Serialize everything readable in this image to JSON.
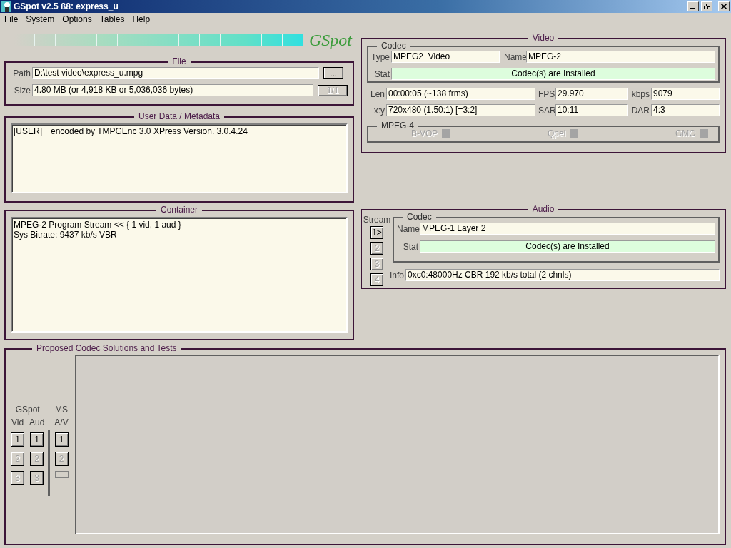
{
  "window": {
    "title": "GSpot v2.5 ß8: express_u"
  },
  "menu": [
    "File",
    "System",
    "Options",
    "Tables",
    "Help"
  ],
  "logo": {
    "text": "GSpot"
  },
  "file": {
    "title": "File",
    "path": {
      "label": "Path",
      "value": "D:\\test video\\express_u.mpg"
    },
    "size": {
      "label": "Size",
      "value": "4.80 MB (or 4,918 KB or 5,036,036 bytes)"
    },
    "browse_button": {
      "label": "...",
      "disabled": false
    },
    "counter_button": {
      "label": "1/1",
      "disabled": true
    }
  },
  "user_data": {
    "title": "User Data / Metadata",
    "lines": [
      {
        "tag": "[USER]",
        "text": "encoded by TMPGEnc 3.0 XPress Version. 3.0.4.24"
      }
    ]
  },
  "container": {
    "title": "Container",
    "lines": [
      "MPEG-2 Program Stream << { 1 vid, 1 aud }",
      "Sys Bitrate: 9437 kb/s VBR"
    ]
  },
  "video": {
    "title": "Video",
    "codec": {
      "title": "Codec",
      "type": {
        "label": "Type",
        "value": "MPEG2_Video"
      },
      "name": {
        "label": "Name",
        "value": "MPEG-2"
      },
      "stat": {
        "label": "Stat",
        "value": "Codec(s) are Installed"
      }
    },
    "fields": [
      {
        "label": "Len",
        "value": "00:00:05 (~138 frms)"
      },
      {
        "label": "FPS",
        "value": "29.970"
      },
      {
        "label": "kbps",
        "value": "9079"
      },
      {
        "label": "x:y",
        "value": "720x480 (1.50:1) [=3:2]"
      },
      {
        "label": "SAR",
        "value": "10:11"
      },
      {
        "label": "DAR",
        "value": "4:3"
      }
    ],
    "mpeg4": {
      "title": "MPEG-4",
      "flags": [
        {
          "label": "B-VOP",
          "disabled": true
        },
        {
          "label": "Qpel",
          "disabled": true
        },
        {
          "label": "GMC",
          "disabled": true
        }
      ]
    }
  },
  "audio": {
    "title": "Audio",
    "stream_label": "Stream",
    "streams": [
      {
        "label": "1>",
        "disabled": false
      },
      {
        "label": "2",
        "disabled": true
      },
      {
        "label": "3",
        "disabled": true
      },
      {
        "label": "4",
        "disabled": true
      }
    ],
    "codec": {
      "title": "Codec",
      "name": {
        "label": "Name",
        "value": "MPEG-1 Layer 2"
      },
      "stat": {
        "label": "Stat",
        "value": "Codec(s) are Installed"
      }
    },
    "info": {
      "label": "Info",
      "value": "0xc0:48000Hz CBR 192 kb/s total (2 chnls)"
    }
  },
  "proposed": {
    "title": "Proposed Codec Solutions and Tests",
    "groups": [
      {
        "label": "GSpot",
        "columns": [
          {
            "label": "Vid",
            "buttons": [
              {
                "kind": "button",
                "label": "1",
                "disabled": false
              },
              {
                "kind": "button",
                "label": "2",
                "disabled": true
              },
              {
                "kind": "button",
                "label": "3",
                "disabled": true
              }
            ]
          },
          {
            "label": "Aud",
            "buttons": [
              {
                "kind": "button",
                "label": "1",
                "disabled": false
              },
              {
                "kind": "button",
                "label": "2",
                "disabled": true
              },
              {
                "kind": "button",
                "label": "3",
                "disabled": true
              }
            ]
          }
        ]
      },
      {
        "label": "MS",
        "columns": [
          {
            "label": "A/V",
            "buttons": [
              {
                "kind": "button",
                "label": "1",
                "disabled": false
              },
              {
                "kind": "button",
                "label": "2",
                "disabled": true
              },
              {
                "kind": "blank"
              }
            ]
          }
        ]
      }
    ]
  }
}
